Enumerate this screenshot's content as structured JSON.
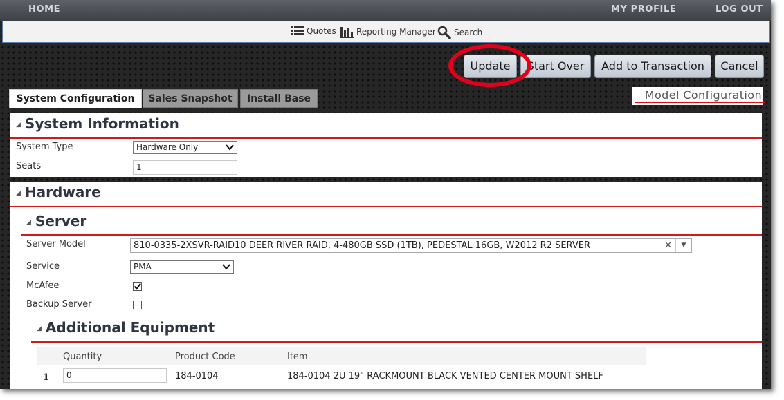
{
  "nav": {
    "home": "HOME",
    "my_profile": "MY PROFILE",
    "log_out": "LOG OUT"
  },
  "toolbar": {
    "quotes": "Quotes",
    "reporting_manager": "Reporting Manager",
    "search": "Search"
  },
  "actions": {
    "update": "Update",
    "start_over": "Start Over",
    "add_to_transaction": "Add to Transaction",
    "cancel": "Cancel"
  },
  "tabs": [
    {
      "label": "System Configuration",
      "active": true
    },
    {
      "label": "Sales Snapshot",
      "active": false
    },
    {
      "label": "Install Base",
      "active": false
    }
  ],
  "model_configuration": "Model Configuration",
  "system_information": {
    "title": "System Information",
    "system_type_label": "System Type",
    "system_type_value": "Hardware Only",
    "seats_label": "Seats",
    "seats_value": "1"
  },
  "hardware": {
    "title": "Hardware",
    "server": {
      "title": "Server",
      "server_model_label": "Server Model",
      "server_model_value": "810-0335-2XSVR-RAID10 DEER RIVER RAID, 4-480GB SSD (1TB), PEDESTAL 16GB, W2012 R2 SERVER",
      "service_label": "Service",
      "service_value": "PMA",
      "mcafee_label": "McAfee",
      "mcafee_checked": true,
      "backup_label": "Backup Server",
      "backup_checked": false
    },
    "additional_equipment": {
      "title": "Additional Equipment",
      "columns": [
        "Quantity",
        "Product Code",
        "Item"
      ],
      "rows": [
        {
          "num": "1",
          "quantity": "0",
          "product_code": "184-0104",
          "item": "184-0104 2U 19\" RACKMOUNT BLACK VENTED CENTER MOUNT SHELF"
        }
      ]
    }
  },
  "colors": {
    "accent_red": "#d21a1a",
    "highlight_circle": "#e3001b",
    "nav_bg": "#4a4d52"
  }
}
